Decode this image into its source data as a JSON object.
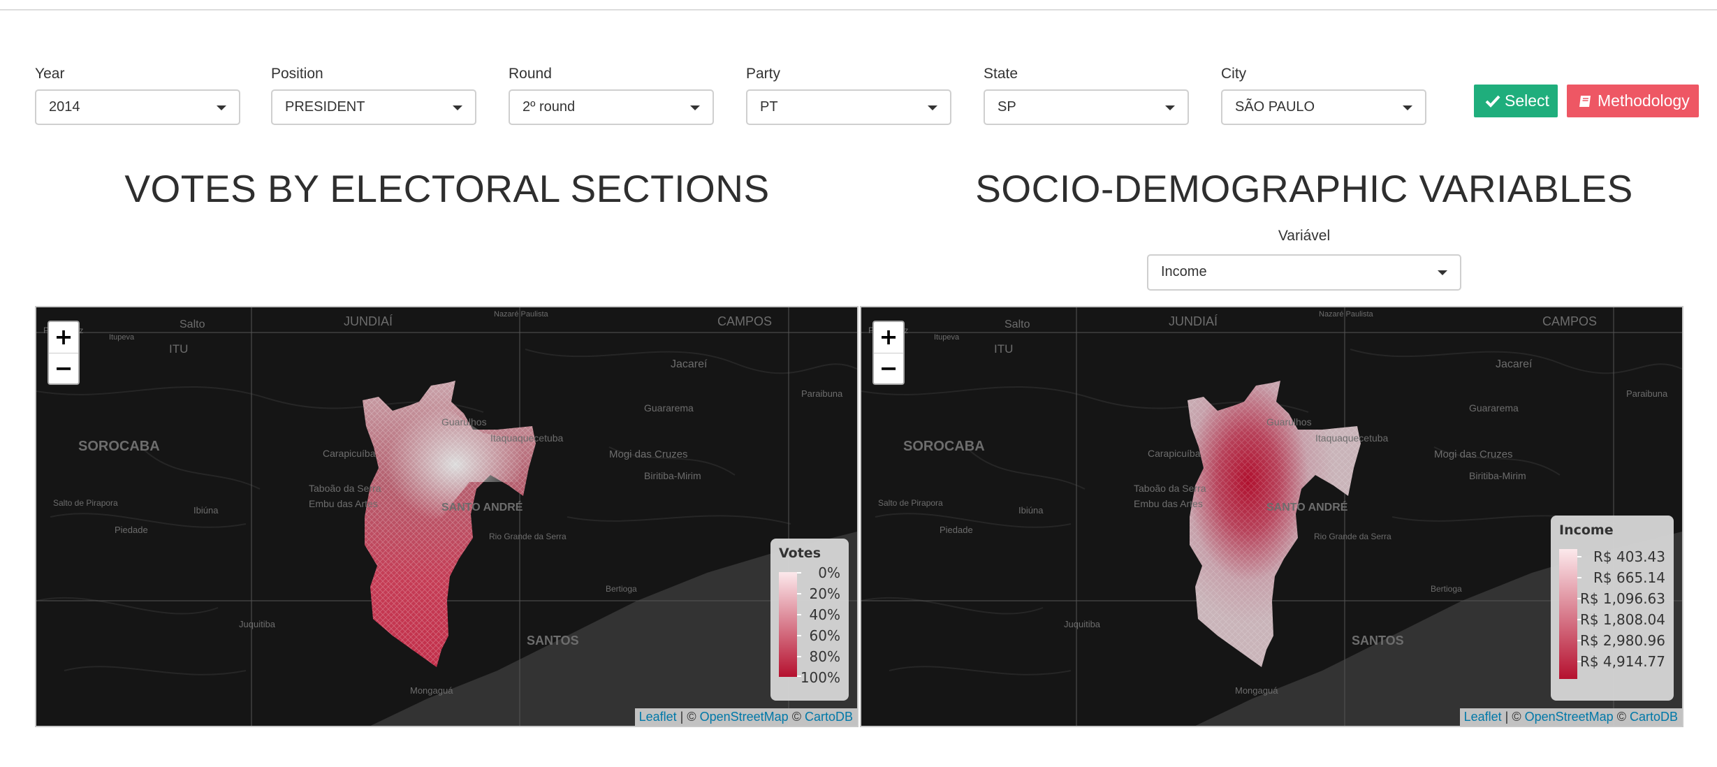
{
  "filters": [
    {
      "label": "Year",
      "value": "2014"
    },
    {
      "label": "Position",
      "value": "PRESIDENT"
    },
    {
      "label": "Round",
      "value": "2º round"
    },
    {
      "label": "Party",
      "value": "PT"
    },
    {
      "label": "State",
      "value": "SP"
    },
    {
      "label": "City",
      "value": "SÃO PAULO"
    }
  ],
  "buttons": {
    "select": "Select",
    "methodology": "Methodology"
  },
  "left_panel": {
    "title": "VOTES BY ELECTORAL SECTIONS"
  },
  "right_panel": {
    "title": "SOCIO-DEMOGRAPHIC VARIABLES",
    "variable_label": "Variável",
    "variable_value": "Income"
  },
  "map": {
    "zoom_in": "+",
    "zoom_out": "−",
    "place_names": [
      "Salto",
      "JUNDIAÍ",
      "CAMPOS",
      "ITU",
      "Jacareí",
      "SOROCABA",
      "Guarulhos",
      "Itaquaquecetuba",
      "Guararema",
      "Carapicuíba",
      "Mogi das Cruzes",
      "Biritiba-Mirim",
      "Taboão da Serra",
      "Embu das Artes",
      "SANTO ANDRÉ",
      "Salto de Pirapora",
      "Ibiúna",
      "Piedade",
      "Rio Grande da Serra",
      "Bertioga",
      "Juquitiba",
      "SANTOS",
      "Mongaguá",
      "Paraibuna",
      "Itupeva",
      "Nazaré Paulista",
      "Porto Feliz"
    ],
    "attribution": {
      "leaflet": "Leaflet",
      "sep1": " | © ",
      "osm": "OpenStreetMap",
      "sep2": " © ",
      "carto": "CartoDB"
    }
  },
  "legends": {
    "votes": {
      "title": "Votes",
      "labels": [
        "0%",
        "20%",
        "40%",
        "60%",
        "80%",
        "100%"
      ]
    },
    "income": {
      "title": "Income",
      "labels": [
        "R$ 403.43",
        "R$ 665.14",
        "R$ 1,096.63",
        "R$ 1,808.04",
        "R$ 2,980.96",
        "R$ 4,914.77"
      ]
    }
  },
  "colors": {
    "select_button": "#1fae7c",
    "methodology_button": "#ee5764",
    "choropleth_low": "#fce9ec",
    "choropleth_high": "#b5112f",
    "basemap": "#151515"
  }
}
